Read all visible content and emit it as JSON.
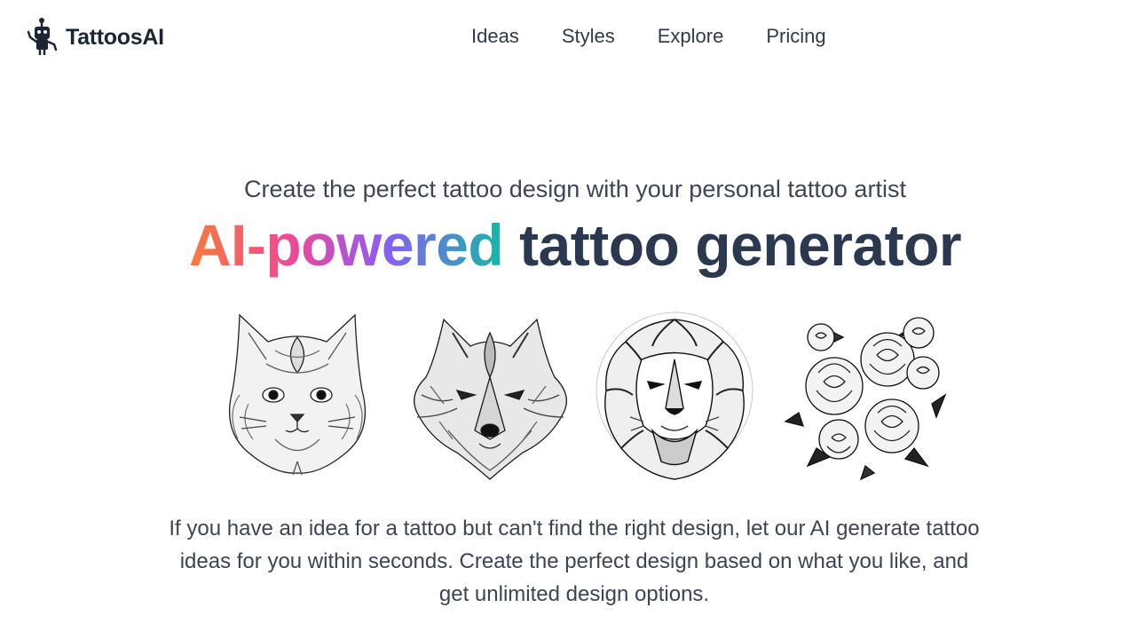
{
  "brand": {
    "name": "TattoosAI",
    "icon": "robot-icon"
  },
  "nav": {
    "items": [
      {
        "label": "Ideas"
      },
      {
        "label": "Styles"
      },
      {
        "label": "Explore"
      },
      {
        "label": "Pricing"
      }
    ]
  },
  "hero": {
    "subtitle": "Create the perfect tattoo design with your personal tattoo artist",
    "title_highlight": "AI-powered",
    "title_rest": "tattoo generator",
    "gradient_colors": [
      "#f97a3a",
      "#ec4899",
      "#8b5cf6",
      "#14b8a6"
    ],
    "description": "If you have an idea for a tattoo but can't find the right design, let our AI generate tattoo ideas for you within seconds. Create the perfect design based on what you like, and get unlimited design options."
  },
  "gallery": {
    "items": [
      {
        "subject": "cat",
        "icon": "cat-tattoo-image"
      },
      {
        "subject": "wolf",
        "icon": "wolf-tattoo-image"
      },
      {
        "subject": "lion",
        "icon": "lion-tattoo-image"
      },
      {
        "subject": "roses",
        "icon": "roses-tattoo-image"
      }
    ]
  }
}
